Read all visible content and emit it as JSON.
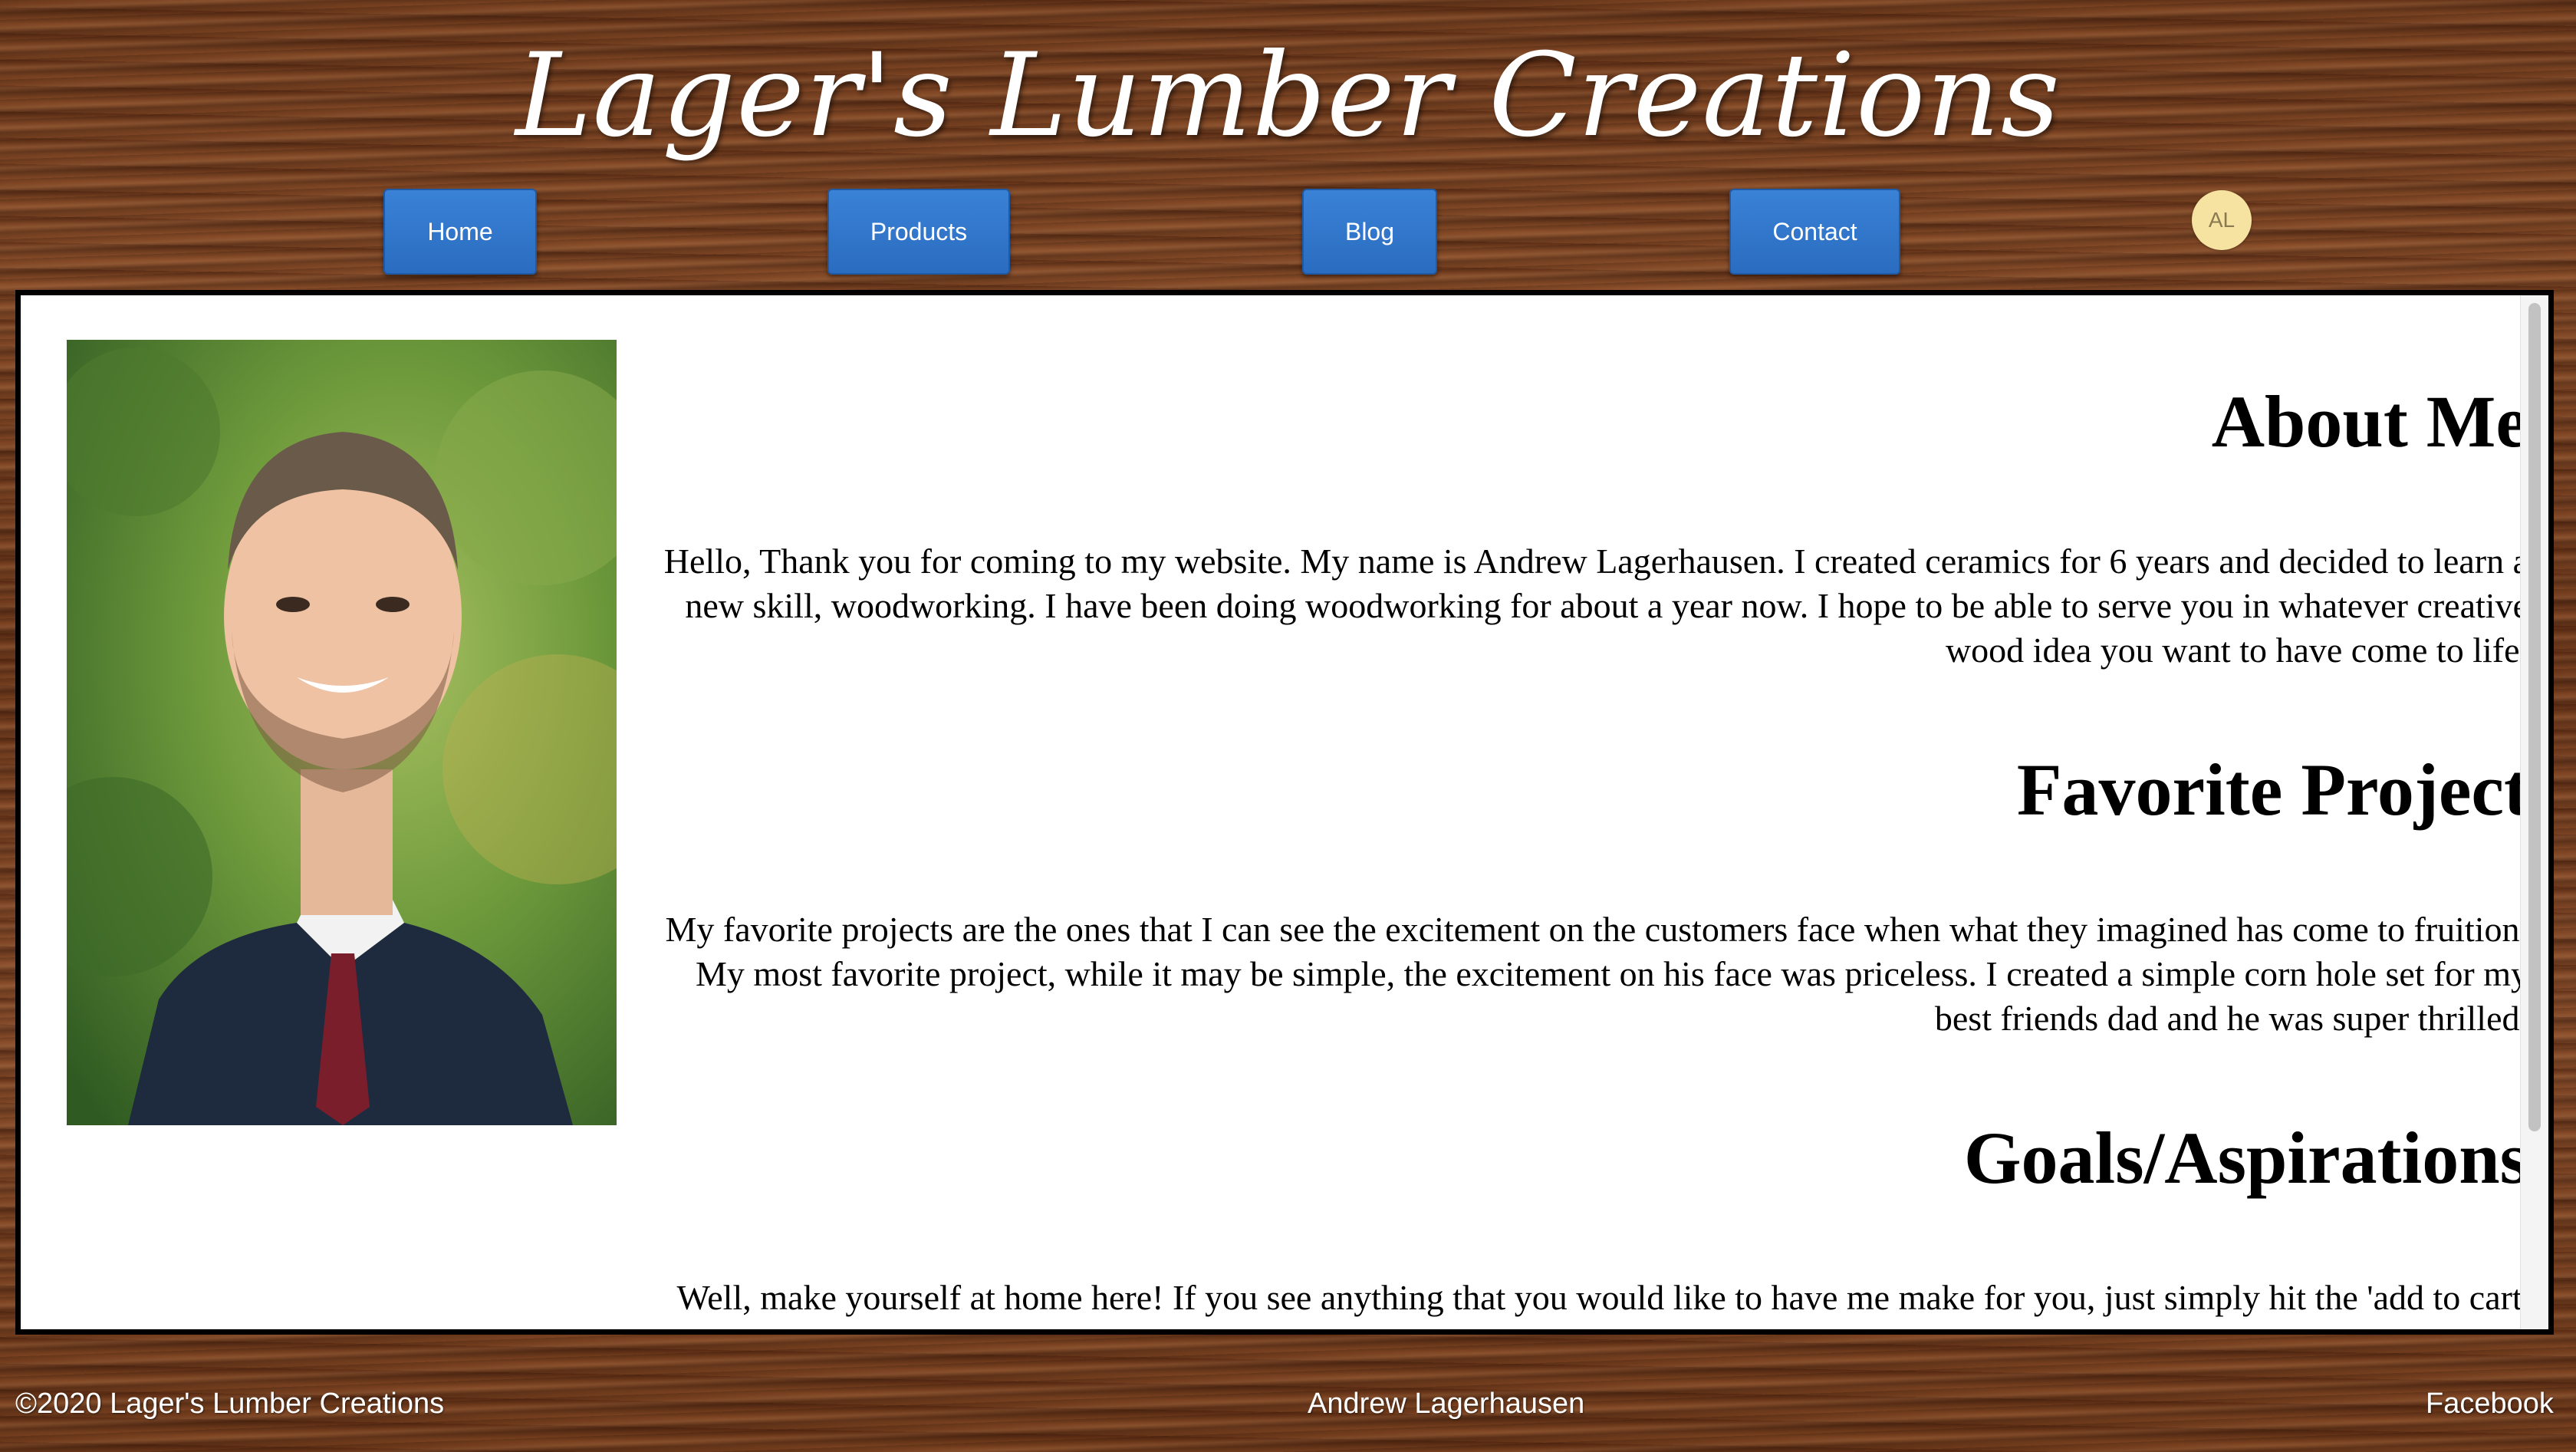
{
  "header": {
    "site_title": "Lager's Lumber Creations"
  },
  "nav": {
    "home": "Home",
    "products": "Products",
    "blog": "Blog",
    "contact": "Contact",
    "avatar_initials": "AL"
  },
  "main": {
    "about_heading": "About Me",
    "about_text": "Hello, Thank you for coming to my website. My name is Andrew Lagerhausen. I created ceramics for 6 years and decided to learn a new skill, woodworking. I have been doing woodworking for about a year now. I hope to be able to serve you in whatever creative wood idea you want to have come to life.",
    "favorite_heading": "Favorite Project",
    "favorite_text": "My favorite projects are the ones that I can see the excitement on the customers face when what they imagined has come to fruition. My most favorite project, while it may be simple, the excitement on his face was priceless. I created a simple corn hole set for my best friends dad and he was super thrilled.",
    "goals_heading": "Goals/Aspirations",
    "goals_text": "Well, make yourself at home here! If you see anything that you would like to have me make for you, just simply hit the 'add to cart' button by each product and it will put it in your shopping cart. Whenever you go to checkout it will send me a"
  },
  "footer": {
    "copyright": "©2020 Lager's Lumber Creations",
    "author": "Andrew Lagerhausen",
    "social": "Facebook"
  },
  "colors": {
    "nav_button": "#2a6cc0",
    "avatar_bg": "#f6e3a1",
    "wood_background": "#6e3a1c"
  }
}
